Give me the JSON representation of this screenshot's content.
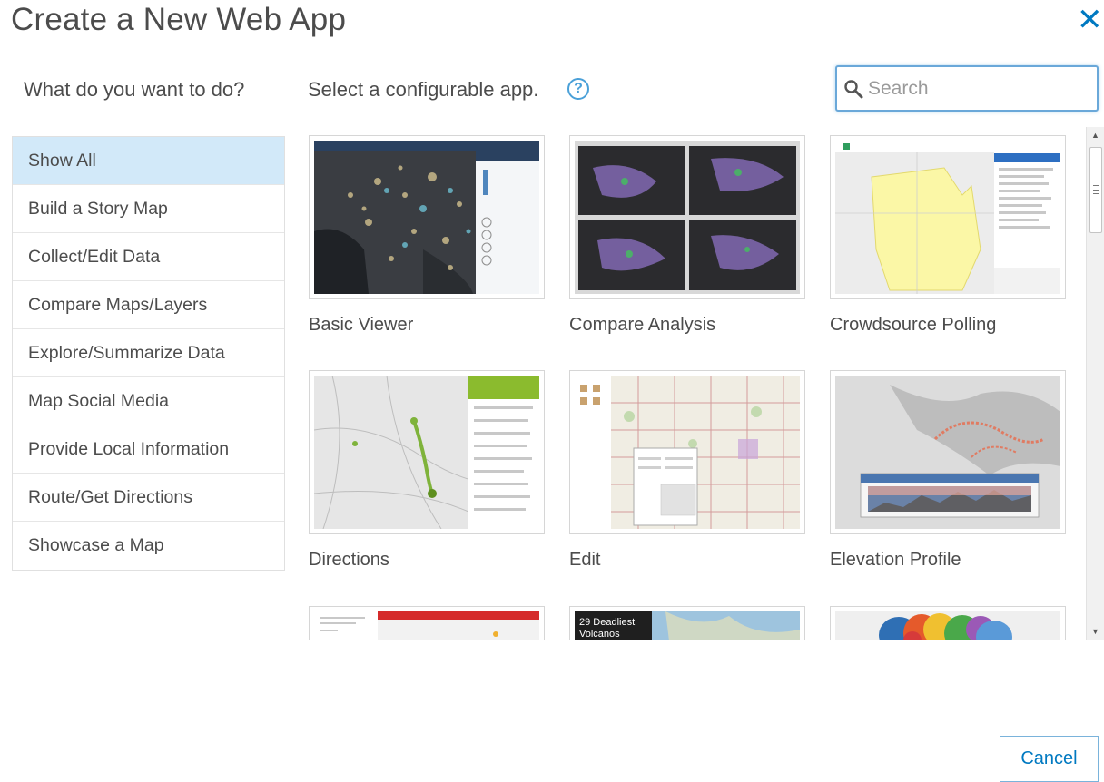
{
  "dialog": {
    "title": "Create a New Web App",
    "close_glyph": "✕",
    "cancel_label": "Cancel"
  },
  "sidebar": {
    "heading": "What do you want to do?",
    "items": [
      {
        "label": "Show All",
        "active": true
      },
      {
        "label": "Build a Story Map"
      },
      {
        "label": "Collect/Edit Data"
      },
      {
        "label": "Compare Maps/Layers"
      },
      {
        "label": "Explore/Summarize Data"
      },
      {
        "label": "Map Social Media"
      },
      {
        "label": "Provide Local Information"
      },
      {
        "label": "Route/Get Directions"
      },
      {
        "label": "Showcase a Map"
      }
    ]
  },
  "main": {
    "heading": "Select a configurable app.",
    "help_glyph": "?",
    "search": {
      "placeholder": "Search",
      "value": ""
    },
    "apps": [
      {
        "label": "Basic Viewer",
        "thumb": "basic"
      },
      {
        "label": "Compare Analysis",
        "thumb": "compare"
      },
      {
        "label": "Crowdsource Polling",
        "thumb": "crowd"
      },
      {
        "label": "Directions",
        "thumb": "directions"
      },
      {
        "label": "Edit",
        "thumb": "edit"
      },
      {
        "label": "Elevation Profile",
        "thumb": "elevation"
      },
      {
        "label": "",
        "thumb": "emergency"
      },
      {
        "label": "",
        "thumb": "volcanos",
        "thumb_text": [
          "29 Deadliest",
          "Volcanos"
        ]
      },
      {
        "label": "",
        "thumb": "bubbles"
      }
    ]
  },
  "colors": {
    "accent": "#0079c1",
    "selected_bg": "#d2e9f9",
    "text": "#4c4c4c"
  }
}
